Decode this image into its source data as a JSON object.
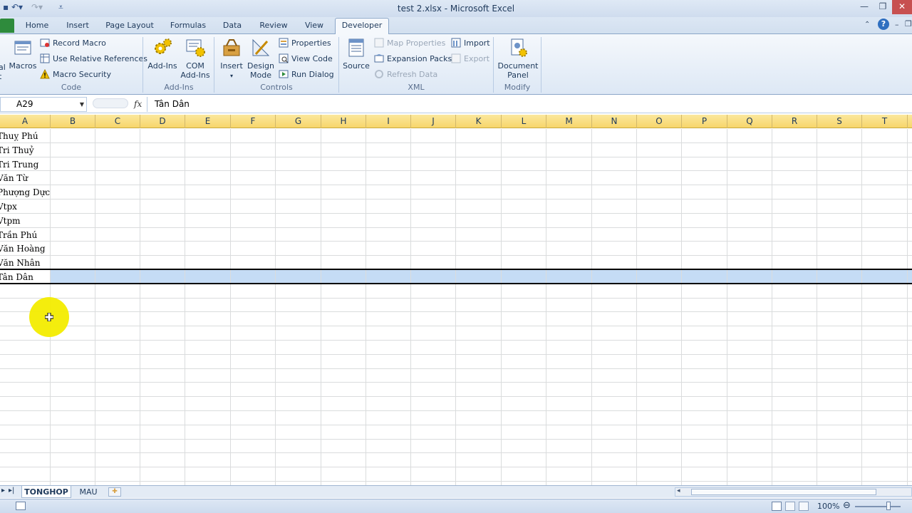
{
  "window": {
    "title": "test 2.xlsx  -  Microsoft Excel",
    "minimize_glyph": "—",
    "restore_glyph": "❐",
    "close_glyph": "✕"
  },
  "tabs": [
    {
      "label": "Home"
    },
    {
      "label": "Insert"
    },
    {
      "label": "Page Layout"
    },
    {
      "label": "Formulas"
    },
    {
      "label": "Data"
    },
    {
      "label": "Review"
    },
    {
      "label": "View"
    },
    {
      "label": "Developer",
      "active": true
    }
  ],
  "ribbon": {
    "code": {
      "label": "Code",
      "visual_basic_partial": "al\nt",
      "macros": "Macros",
      "record_macro": "Record Macro",
      "use_relative_references": "Use Relative References",
      "macro_security": "Macro Security"
    },
    "addins": {
      "label": "Add-Ins",
      "add_ins": "Add-Ins",
      "com_add_ins_line1": "COM",
      "com_add_ins_line2": "Add-Ins"
    },
    "controls": {
      "label": "Controls",
      "insert": "Insert",
      "design_mode_line1": "Design",
      "design_mode_line2": "Mode",
      "properties": "Properties",
      "view_code": "View Code",
      "run_dialog": "Run Dialog"
    },
    "xml": {
      "label": "XML",
      "source": "Source",
      "map_properties": "Map Properties",
      "expansion_packs": "Expansion Packs",
      "refresh_data": "Refresh Data",
      "import": "Import",
      "export": "Export"
    },
    "modify": {
      "label": "Modify",
      "document_panel_line1": "Document",
      "document_panel_line2": "Panel"
    }
  },
  "formula_bar": {
    "name_box": "A29",
    "fx": "fx",
    "value": "Tân Dân"
  },
  "columns": [
    "A",
    "B",
    "C",
    "D",
    "E",
    "F",
    "G",
    "H",
    "I",
    "J",
    "K",
    "L",
    "M",
    "N",
    "O",
    "P",
    "Q",
    "R",
    "S",
    "T"
  ],
  "rows": [
    "Thuỵ Phú",
    "Tri Thuỷ",
    "Tri Trung",
    "Văn Từ",
    "Phượng Dực",
    "Vtpx",
    "Vtpm",
    "Trần Phú",
    "Văn Hoàng",
    "Văn Nhân",
    "Tân Dân"
  ],
  "sheets": [
    {
      "name": "TONGHOP",
      "active": true
    },
    {
      "name": "MAU",
      "active": false
    }
  ],
  "status": {
    "zoom": "100%"
  }
}
